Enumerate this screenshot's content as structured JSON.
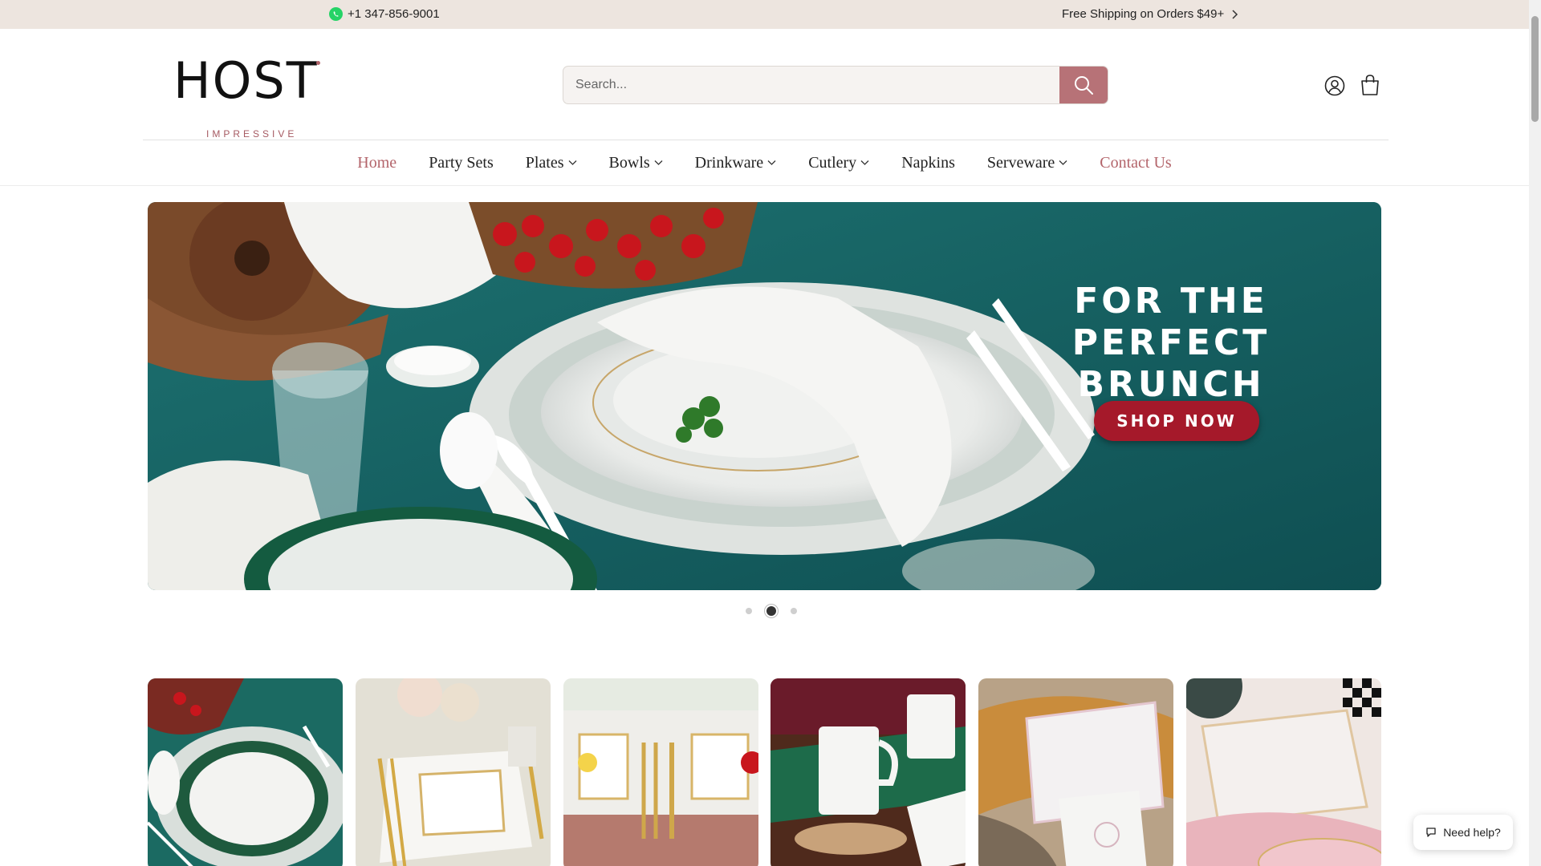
{
  "announcement": {
    "phone": "+1 347-856-9001",
    "shipping": "Free Shipping on Orders $49+"
  },
  "logo": {
    "word": "HOST",
    "sub": "IMPRESSIVE"
  },
  "search": {
    "placeholder": "Search..."
  },
  "nav": {
    "items": [
      {
        "label": "Home",
        "dropdown": false,
        "accent": true
      },
      {
        "label": "Party Sets",
        "dropdown": false,
        "accent": false
      },
      {
        "label": "Plates",
        "dropdown": true,
        "accent": false
      },
      {
        "label": "Bowls",
        "dropdown": true,
        "accent": false
      },
      {
        "label": "Drinkware",
        "dropdown": true,
        "accent": false
      },
      {
        "label": "Cutlery",
        "dropdown": true,
        "accent": false
      },
      {
        "label": "Napkins",
        "dropdown": false,
        "accent": false
      },
      {
        "label": "Serveware",
        "dropdown": true,
        "accent": false
      },
      {
        "label": "Contact Us",
        "dropdown": false,
        "accent": true
      }
    ]
  },
  "hero": {
    "title_line1": "FOR THE PERFECT",
    "title_line2": "BRUNCH",
    "cta": "SHOP NOW",
    "slides": 3,
    "active_slide": 2
  },
  "help": {
    "label": "Need help?"
  },
  "colors": {
    "accent": "#b3646a",
    "announce_bg": "#ede5df",
    "search_button": "#b77277",
    "cta": "#a5192a",
    "hero_teal": "#1a6b6a"
  },
  "icons": [
    "whatsapp-icon",
    "chevron-right-icon",
    "search-icon",
    "account-icon",
    "cart-icon",
    "chevron-down-icon",
    "chat-icon"
  ]
}
